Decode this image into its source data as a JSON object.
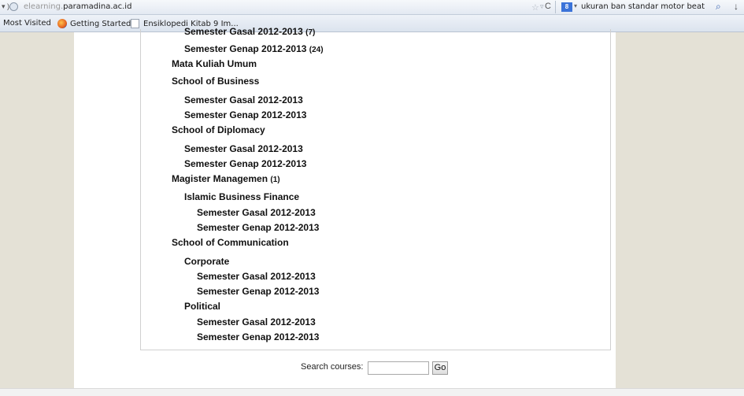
{
  "browser": {
    "url_prefix": "elearning.",
    "url_domain": "paramadina.ac.id",
    "search_query": "ukuran ban standar motor beat",
    "back_glyph": "▾ )",
    "star_glyph": "☆",
    "dropmark_glyph": "▿",
    "reload_glyph": "C",
    "engine_glyph": "8",
    "engine_caret": "▾",
    "search_go_glyph": "⌕",
    "download_glyph": "↓"
  },
  "bookmarks": {
    "items": [
      "Most Visited",
      "Getting Started",
      "Ensiklopedi Kitab 9 Im..."
    ]
  },
  "categories": [
    {
      "label": "Semester Gasal 2012-2013",
      "count": "(7)"
    },
    {
      "label": "Semester Genap 2012-2013",
      "count": "(24)"
    },
    {
      "label": "Mata Kuliah Umum",
      "count": ""
    },
    {
      "label": "School of Business",
      "count": ""
    },
    {
      "label": "Semester Gasal 2012-2013",
      "count": ""
    },
    {
      "label": "Semester Genap 2012-2013",
      "count": ""
    },
    {
      "label": "School of Diplomacy",
      "count": ""
    },
    {
      "label": "Semester Gasal 2012-2013",
      "count": ""
    },
    {
      "label": "Semester Genap 2012-2013",
      "count": ""
    },
    {
      "label": "Magister Managemen",
      "count": "(1)"
    },
    {
      "label": "Islamic Business Finance",
      "count": ""
    },
    {
      "label": "Semester Gasal 2012-2013",
      "count": ""
    },
    {
      "label": "Semester Genap 2012-2013",
      "count": ""
    },
    {
      "label": "School of Communication",
      "count": ""
    },
    {
      "label": "Corporate",
      "count": ""
    },
    {
      "label": "Semester Gasal 2012-2013",
      "count": ""
    },
    {
      "label": "Semester Genap 2012-2013",
      "count": ""
    },
    {
      "label": "Political",
      "count": ""
    },
    {
      "label": "Semester Gasal 2012-2013",
      "count": ""
    },
    {
      "label": "Semester Genap 2012-2013",
      "count": ""
    }
  ],
  "search": {
    "label": "Search courses:",
    "value": "",
    "button": "Go"
  }
}
